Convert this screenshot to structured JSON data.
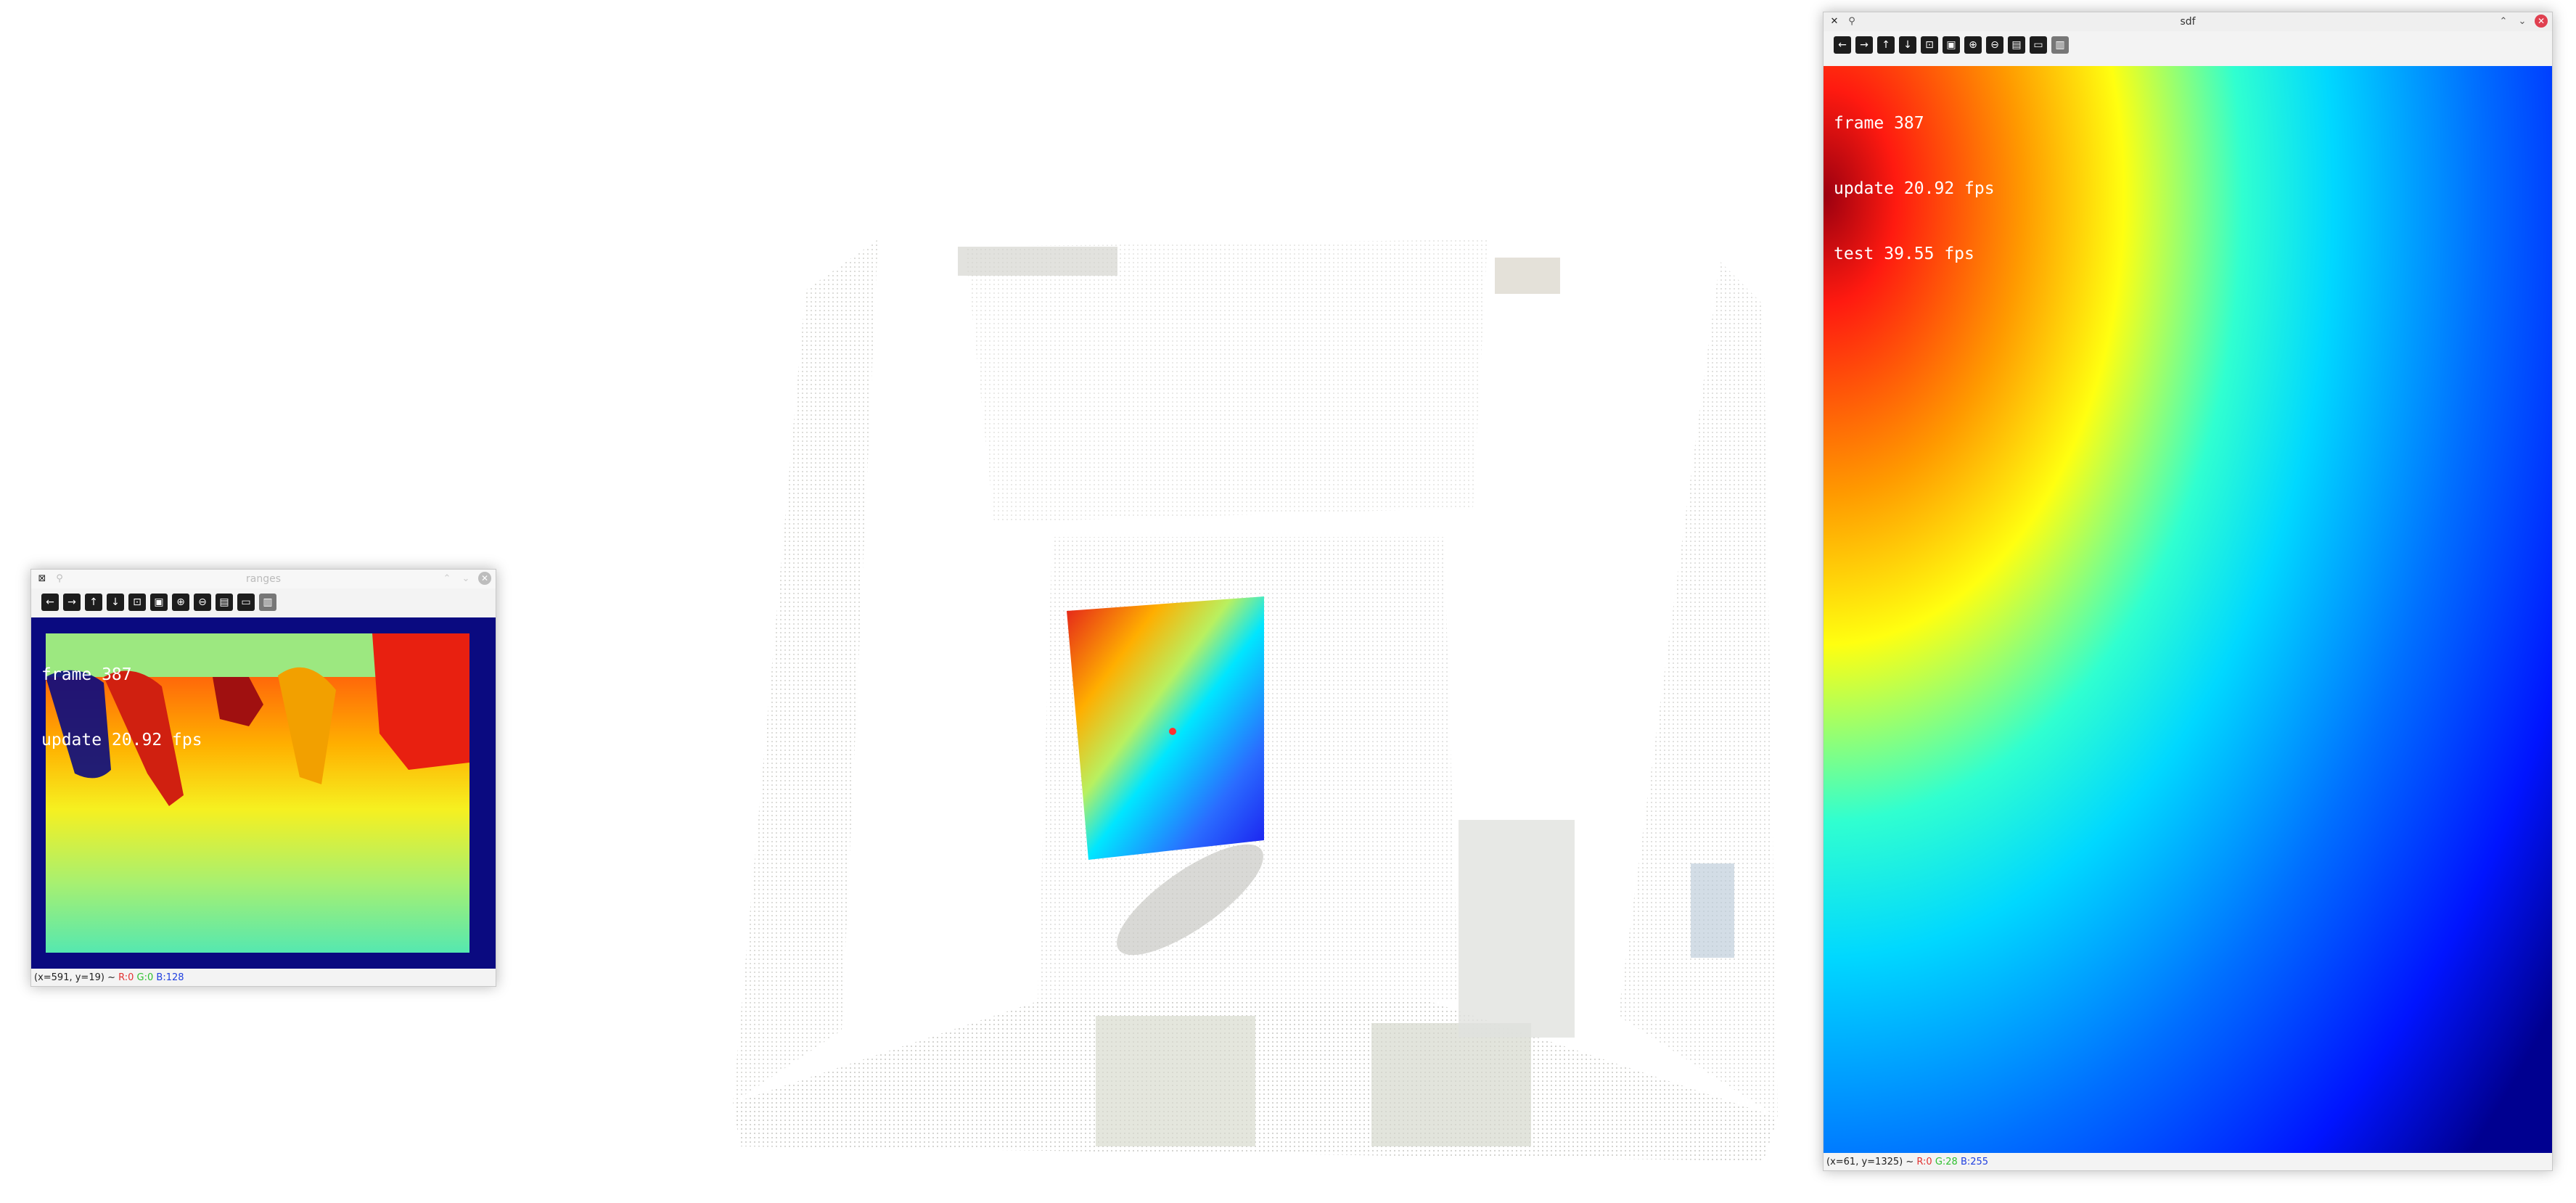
{
  "ranges_window": {
    "title": "ranges",
    "overlay": [
      "frame 387",
      "update 20.92 fps"
    ],
    "status": {
      "coords": "(x=591, y=19) ~",
      "r": "R:0",
      "g": "G:0",
      "b": "B:128"
    }
  },
  "sdf_window": {
    "title": "sdf",
    "overlay": [
      "frame 387",
      "update 20.92 fps",
      "test 39.55 fps"
    ],
    "status": {
      "coords": "(x=61, y=1325) ~",
      "r": "R:0",
      "g": "G:28",
      "b": "B:255"
    }
  },
  "toolbar_icons": [
    "pan-left-icon",
    "pan-right-icon",
    "pan-up-icon",
    "pan-down-icon",
    "zoom-fit-icon",
    "zoom-original-icon",
    "zoom-in-icon",
    "zoom-out-icon",
    "save-icon",
    "copy-icon",
    "properties-icon"
  ]
}
